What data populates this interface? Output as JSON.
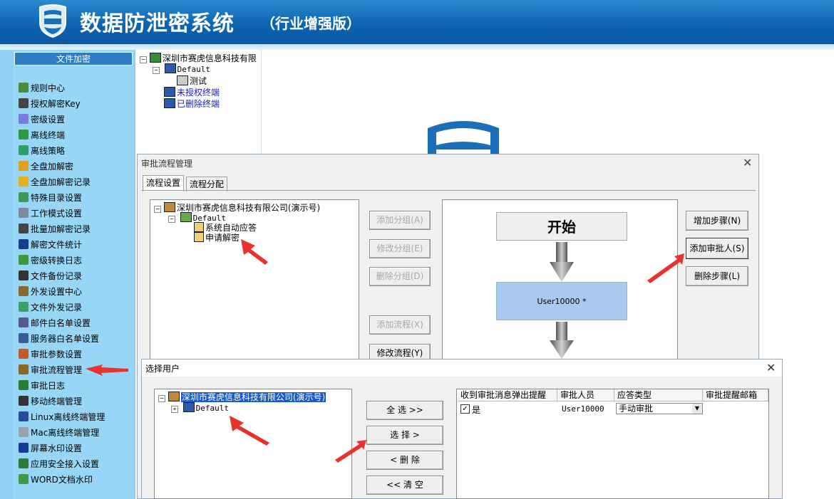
{
  "header": {
    "title": "数据防泄密系统",
    "edition": "（行业增强版）"
  },
  "sidebar": {
    "title": "文件加密",
    "items": [
      {
        "label": "规则中心",
        "icon": "rules-icon",
        "color": "#4a8c3a"
      },
      {
        "label": "授权解密Key",
        "icon": "key-lock-icon",
        "color": "#444444"
      },
      {
        "label": "密级设置",
        "icon": "gear-icon",
        "color": "#7a7adf"
      },
      {
        "label": "离线终端",
        "icon": "check-shield-icon",
        "color": "#2a9a4a"
      },
      {
        "label": "离线策略",
        "icon": "globe-icon",
        "color": "#2aa070"
      },
      {
        "label": "全盘加解密",
        "icon": "disk-icon",
        "color": "#e0a020"
      },
      {
        "label": "全盘加解密记录",
        "icon": "record-icon",
        "color": "#e0b020"
      },
      {
        "label": "特殊目录设置",
        "icon": "folder-gear-icon",
        "color": "#3a9a5a"
      },
      {
        "label": "工作模式设置",
        "icon": "monitor-icon",
        "color": "#7a8a9a"
      },
      {
        "label": "批量加解密记录",
        "icon": "lock-icon",
        "color": "#444444"
      },
      {
        "label": "解密文件统计",
        "icon": "bar-chart-icon",
        "color": "#1a3a8a"
      },
      {
        "label": "密级转换日志",
        "icon": "doc-arrow-icon",
        "color": "#3a9a3a"
      },
      {
        "label": "文件备份记录",
        "icon": "backup-icon",
        "color": "#333333"
      },
      {
        "label": "外发设置中心",
        "icon": "gears-icon",
        "color": "#8a6a2a"
      },
      {
        "label": "文件外发记录",
        "icon": "globe-send-icon",
        "color": "#3aa06a"
      },
      {
        "label": "邮件白名单设置",
        "icon": "mail-icon",
        "color": "#5a5a8a"
      },
      {
        "label": "服务器白名单设置",
        "icon": "server-icon",
        "color": "#3a5a9a"
      },
      {
        "label": "审批参数设置",
        "icon": "approval-icon",
        "color": "#c05a2a"
      },
      {
        "label": "审批流程管理",
        "icon": "workflow-gear-icon",
        "color": "#8a6a1a"
      },
      {
        "label": "审批日志",
        "icon": "log-icon",
        "color": "#2a7a3a"
      },
      {
        "label": "移动终端管理",
        "icon": "mobile-icon",
        "color": "#333333"
      },
      {
        "label": "Linux离线终端管理",
        "icon": "linux-icon",
        "color": "#2a4a9a"
      },
      {
        "label": "Mac离线终端管理",
        "icon": "mac-icon",
        "color": "#9aa0aa"
      },
      {
        "label": "屏幕水印设置",
        "icon": "screen-icon",
        "color": "#1a3a9a"
      },
      {
        "label": "应用安全接入设置",
        "icon": "app-security-icon",
        "color": "#2a7a3a"
      },
      {
        "label": "WORD文档水印",
        "icon": "word-doc-icon",
        "color": "#3a9a4a"
      }
    ]
  },
  "top_tree": {
    "root": "深圳市赛虎信息科技有限",
    "default": "Default",
    "child": "测试",
    "unauth": "未授权终端",
    "deleted": "已删除终端"
  },
  "dialog_approval": {
    "title": "审批流程管理",
    "close": "✕",
    "tabs": [
      "流程设置",
      "流程分配"
    ],
    "tree": {
      "root": "深圳市赛虎信息科技有限公司(演示号)",
      "default": "Default",
      "item1": "系统自动应答",
      "item2": "申请解密"
    },
    "group_buttons": [
      "添加分组(A)",
      "修改分组(E)",
      "删除分组(D)",
      "添加流程(X)",
      "修改流程(Y)"
    ],
    "flow": {
      "start": "开始",
      "user": "User10000 *"
    },
    "step_buttons": [
      "增加步骤(N)",
      "添加审批人(S)",
      "删除步骤(L)"
    ]
  },
  "dialog_select_user": {
    "title": "选择用户",
    "close": "✕",
    "tree": {
      "root": "深圳市赛虎信息科技有限公司(演示号)",
      "default": "Default"
    },
    "buttons": [
      "全  选 >>",
      "选  择 >",
      "< 删  除",
      "<< 清  空"
    ],
    "grid": {
      "headers": [
        "收到审批消息弹出提醒",
        "审批人员",
        "应答类型",
        "审批提醒邮箱"
      ],
      "row": {
        "popup": "是",
        "user": "User10000",
        "answer_type": "手动审批",
        "email": ""
      }
    }
  }
}
